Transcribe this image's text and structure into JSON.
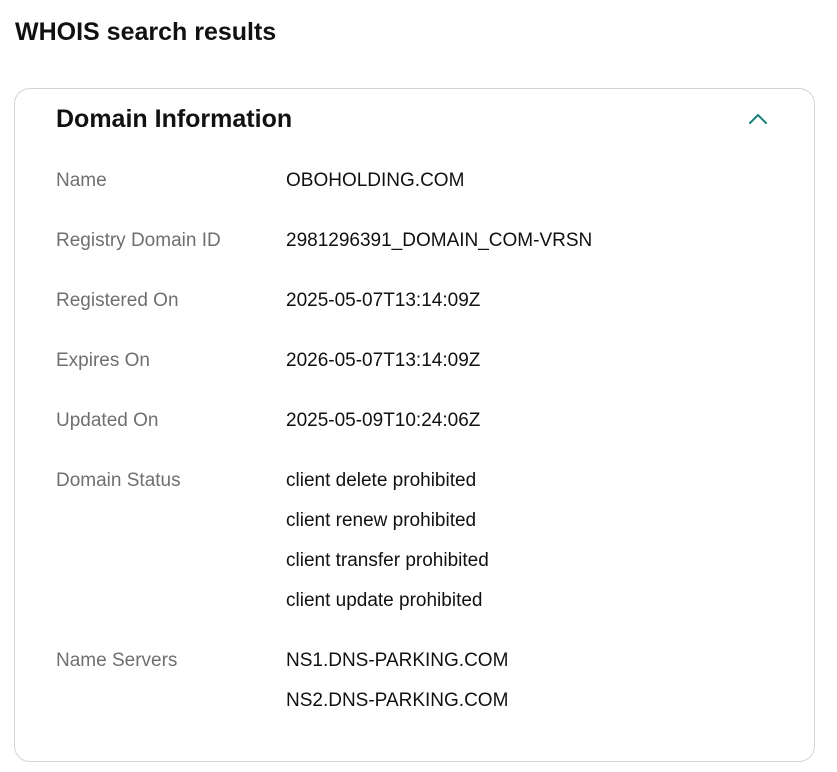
{
  "page": {
    "title": "WHOIS search results"
  },
  "section": {
    "title": "Domain Information",
    "toggle_icon": "chevron-up-icon",
    "accent_color": "#1b7f7a"
  },
  "fields": {
    "name": {
      "label": "Name",
      "value": "OBOHOLDING.COM"
    },
    "registry_domain_id": {
      "label": "Registry Domain ID",
      "value": "2981296391_DOMAIN_COM-VRSN"
    },
    "registered_on": {
      "label": "Registered On",
      "value": "2025-05-07T13:14:09Z"
    },
    "expires_on": {
      "label": "Expires On",
      "value": "2026-05-07T13:14:09Z"
    },
    "updated_on": {
      "label": "Updated On",
      "value": "2025-05-09T10:24:06Z"
    },
    "domain_status": {
      "label": "Domain Status",
      "values": [
        "client delete prohibited",
        "client renew prohibited",
        "client transfer prohibited",
        "client update prohibited"
      ]
    },
    "name_servers": {
      "label": "Name Servers",
      "values": [
        "NS1.DNS-PARKING.COM",
        "NS2.DNS-PARKING.COM"
      ]
    }
  }
}
